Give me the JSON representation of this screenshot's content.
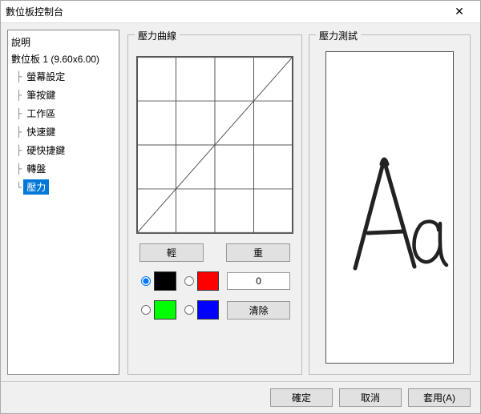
{
  "window": {
    "title": "數位板控制台"
  },
  "tree": {
    "root": "說明",
    "parent": "數位板 1 (9.60x6.00)",
    "items": [
      {
        "label": "螢幕設定",
        "selected": false
      },
      {
        "label": "筆按鍵",
        "selected": false
      },
      {
        "label": "工作區",
        "selected": false
      },
      {
        "label": "快速鍵",
        "selected": false
      },
      {
        "label": "硬快捷鍵",
        "selected": false
      },
      {
        "label": "轉盤",
        "selected": false
      },
      {
        "label": "壓力",
        "selected": true
      }
    ]
  },
  "curve": {
    "title": "壓力曲線",
    "light_label": "輕",
    "heavy_label": "重",
    "grid_cells": 4
  },
  "colors": {
    "black": "#000000",
    "red": "#ff0000",
    "green": "#00ff00",
    "blue": "#0000ff",
    "selected": "black"
  },
  "pressure_value": "0",
  "clear_label": "清除",
  "test": {
    "title": "壓力測試",
    "sample_text": "Aa"
  },
  "footer": {
    "ok": "確定",
    "cancel": "取消",
    "apply": "套用(A)"
  }
}
